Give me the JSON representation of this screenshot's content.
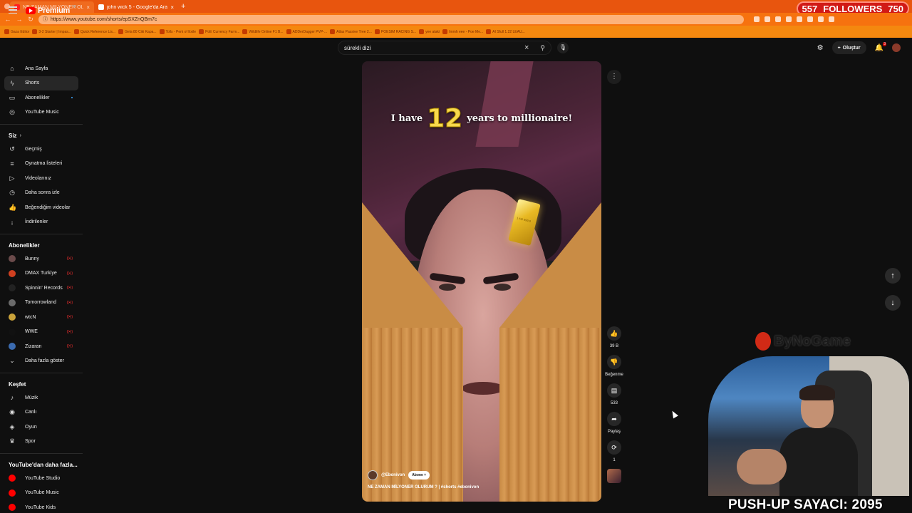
{
  "browser": {
    "tabs": [
      {
        "title": "NE ZAMAN MILYONER OLUR",
        "active": true
      },
      {
        "title": "john wick 5 - Google'da Ara",
        "active": false
      }
    ],
    "url": "https://www.youtube.com/shorts/epSXZnQBm7c",
    "bookmarks": [
      "Gaza Editor",
      "3-2 Starter | Impas...",
      "Quick Reference Lis...",
      "Gela 80 Ciki Kapa...",
      "Tolls - Perk of Exile",
      "PoE Currency Farm...",
      "Wildlife Online F1 B...",
      "ADDerDagger PVP-...",
      "Atlas Passive Tree 2...",
      "POESIM RACING S...",
      "yee ataki",
      "Immh eee - Poe Me...",
      "AI Sfull 1.22 LEAU..."
    ]
  },
  "followers": {
    "current": "557",
    "label": "FOLLOWERS",
    "goal": "750"
  },
  "youtube": {
    "logo": "Premium",
    "logo_sup": "TR",
    "search_value": "sürekli dizi",
    "create_label": "Oluştur",
    "notif_count": "3"
  },
  "sidebar": {
    "main": [
      {
        "label": "Ana Sayfa",
        "icon": "home-icon",
        "glyph": "⌂"
      },
      {
        "label": "Shorts",
        "icon": "shorts-icon",
        "glyph": "ϟ",
        "active": true
      },
      {
        "label": "Abonelikler",
        "icon": "subscriptions-icon",
        "glyph": "▭",
        "dot": true
      },
      {
        "label": "YouTube Music",
        "icon": "music-circle-icon",
        "glyph": "◎"
      }
    ],
    "you_header": "Siz",
    "you": [
      {
        "label": "Geçmiş",
        "icon": "history-icon",
        "glyph": "↺"
      },
      {
        "label": "Oynatma listeleri",
        "icon": "playlist-icon",
        "glyph": "≡"
      },
      {
        "label": "Videolarınız",
        "icon": "your-videos-icon",
        "glyph": "▷"
      },
      {
        "label": "Daha sonra izle",
        "icon": "watch-later-icon",
        "glyph": "◷"
      },
      {
        "label": "Beğendiğim videolar",
        "icon": "liked-icon",
        "glyph": "👍"
      },
      {
        "label": "İndirilenler",
        "icon": "download-icon",
        "glyph": "↓"
      }
    ],
    "subs_header": "Abonelikler",
    "subs": [
      {
        "label": "Bunny",
        "color": "#6b4b4b"
      },
      {
        "label": "DMAX Turkiye",
        "color": "#d04020"
      },
      {
        "label": "Spinnin' Records",
        "color": "#222222"
      },
      {
        "label": "Tomorrowland",
        "color": "#6b6b6b"
      },
      {
        "label": "wtcN",
        "color": "#c9a23a"
      },
      {
        "label": "WWE",
        "color": "#111111"
      },
      {
        "label": "Zizaran",
        "color": "#3b6bb0"
      }
    ],
    "show_more": "Daha fazla göster",
    "explore_header": "Keşfet",
    "explore": [
      {
        "label": "Müzik",
        "icon": "music-note-icon",
        "glyph": "♪"
      },
      {
        "label": "Canlı",
        "icon": "live-icon",
        "glyph": "◉"
      },
      {
        "label": "Oyun",
        "icon": "gaming-icon",
        "glyph": "◈"
      },
      {
        "label": "Spor",
        "icon": "trophy-icon",
        "glyph": "♛"
      }
    ],
    "more_header": "YouTube'dan daha fazla...",
    "more": [
      {
        "label": "YouTube Studio",
        "color": "#ff0000"
      },
      {
        "label": "YouTube Music",
        "color": "#ff0000"
      },
      {
        "label": "YouTube Kids",
        "color": "#ff0000"
      }
    ]
  },
  "short": {
    "headline_pre": "I have",
    "headline_num": "12",
    "headline_post": "years to millionaire!",
    "gold_text": "1 KG 999.9",
    "channel": "@Ebonivon",
    "subscribe": "Abone",
    "title": "NE ZAMAN MİLYONER OLURUM ? | #shorts #ebonivon",
    "likes": "39 B",
    "dislike": "Beğenme",
    "comments": "533",
    "share": "Paylaş",
    "remix": "1"
  },
  "stream": {
    "logo_text": "ByNoGame",
    "pushup": "PUSH-UP SAYACI: 2095"
  }
}
